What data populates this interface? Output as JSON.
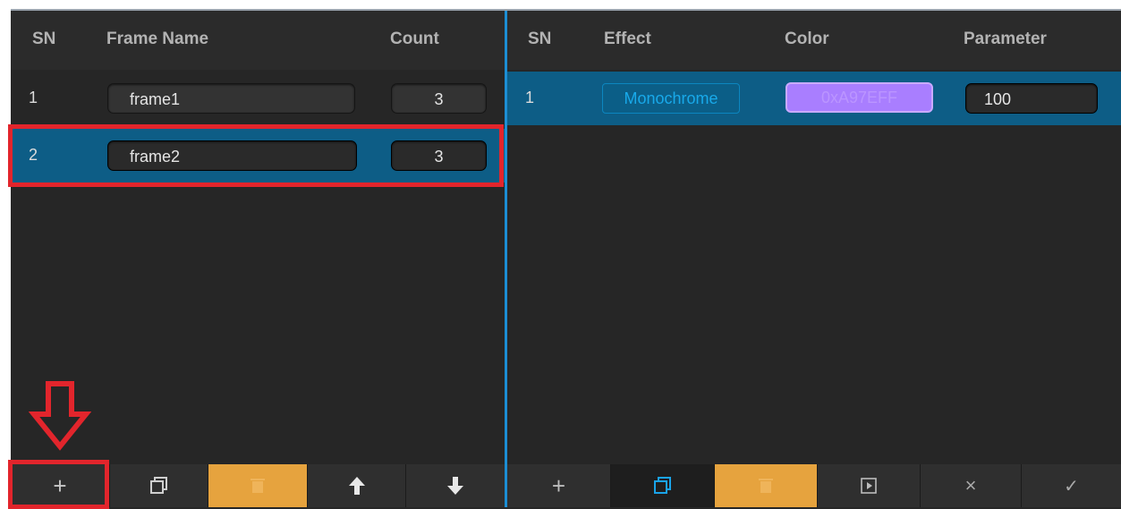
{
  "frame_table": {
    "headers": {
      "sn": "SN",
      "name": "Frame Name",
      "count": "Count"
    },
    "rows": [
      {
        "sn": "1",
        "name": "frame1",
        "count": "3"
      },
      {
        "sn": "2",
        "name": "frame2",
        "count": "3"
      }
    ],
    "selected_row": "2"
  },
  "effect_table": {
    "headers": {
      "sn": "SN",
      "effect": "Effect",
      "color": "Color",
      "parameter": "Parameter"
    },
    "rows": [
      {
        "sn": "1",
        "effect": "Monochrome",
        "color": "0xA97EFF",
        "parameter": "100"
      }
    ]
  },
  "left_toolbar": {
    "buttons": [
      {
        "icon": "plus-icon",
        "label": "+"
      },
      {
        "icon": "copy-icon"
      },
      {
        "icon": "delete-icon"
      },
      {
        "icon": "arrow-up-icon"
      },
      {
        "icon": "arrow-down-icon"
      }
    ]
  },
  "right_toolbar": {
    "buttons": [
      {
        "icon": "plus-icon",
        "label": "+"
      },
      {
        "icon": "copy-icon"
      },
      {
        "icon": "delete-icon"
      },
      {
        "icon": "preview-icon"
      },
      {
        "icon": "close-icon",
        "label": "×"
      },
      {
        "icon": "check-icon",
        "label": "✓"
      }
    ]
  },
  "colors": {
    "panel_bg": "#262626",
    "header_bg": "#2b2b2b",
    "selected_row": "#0d5d86",
    "divider": "#1c8ed4",
    "delete_button": "#e6a33e",
    "effect_color": "#A97EFF",
    "annotation": "#e2252c"
  }
}
